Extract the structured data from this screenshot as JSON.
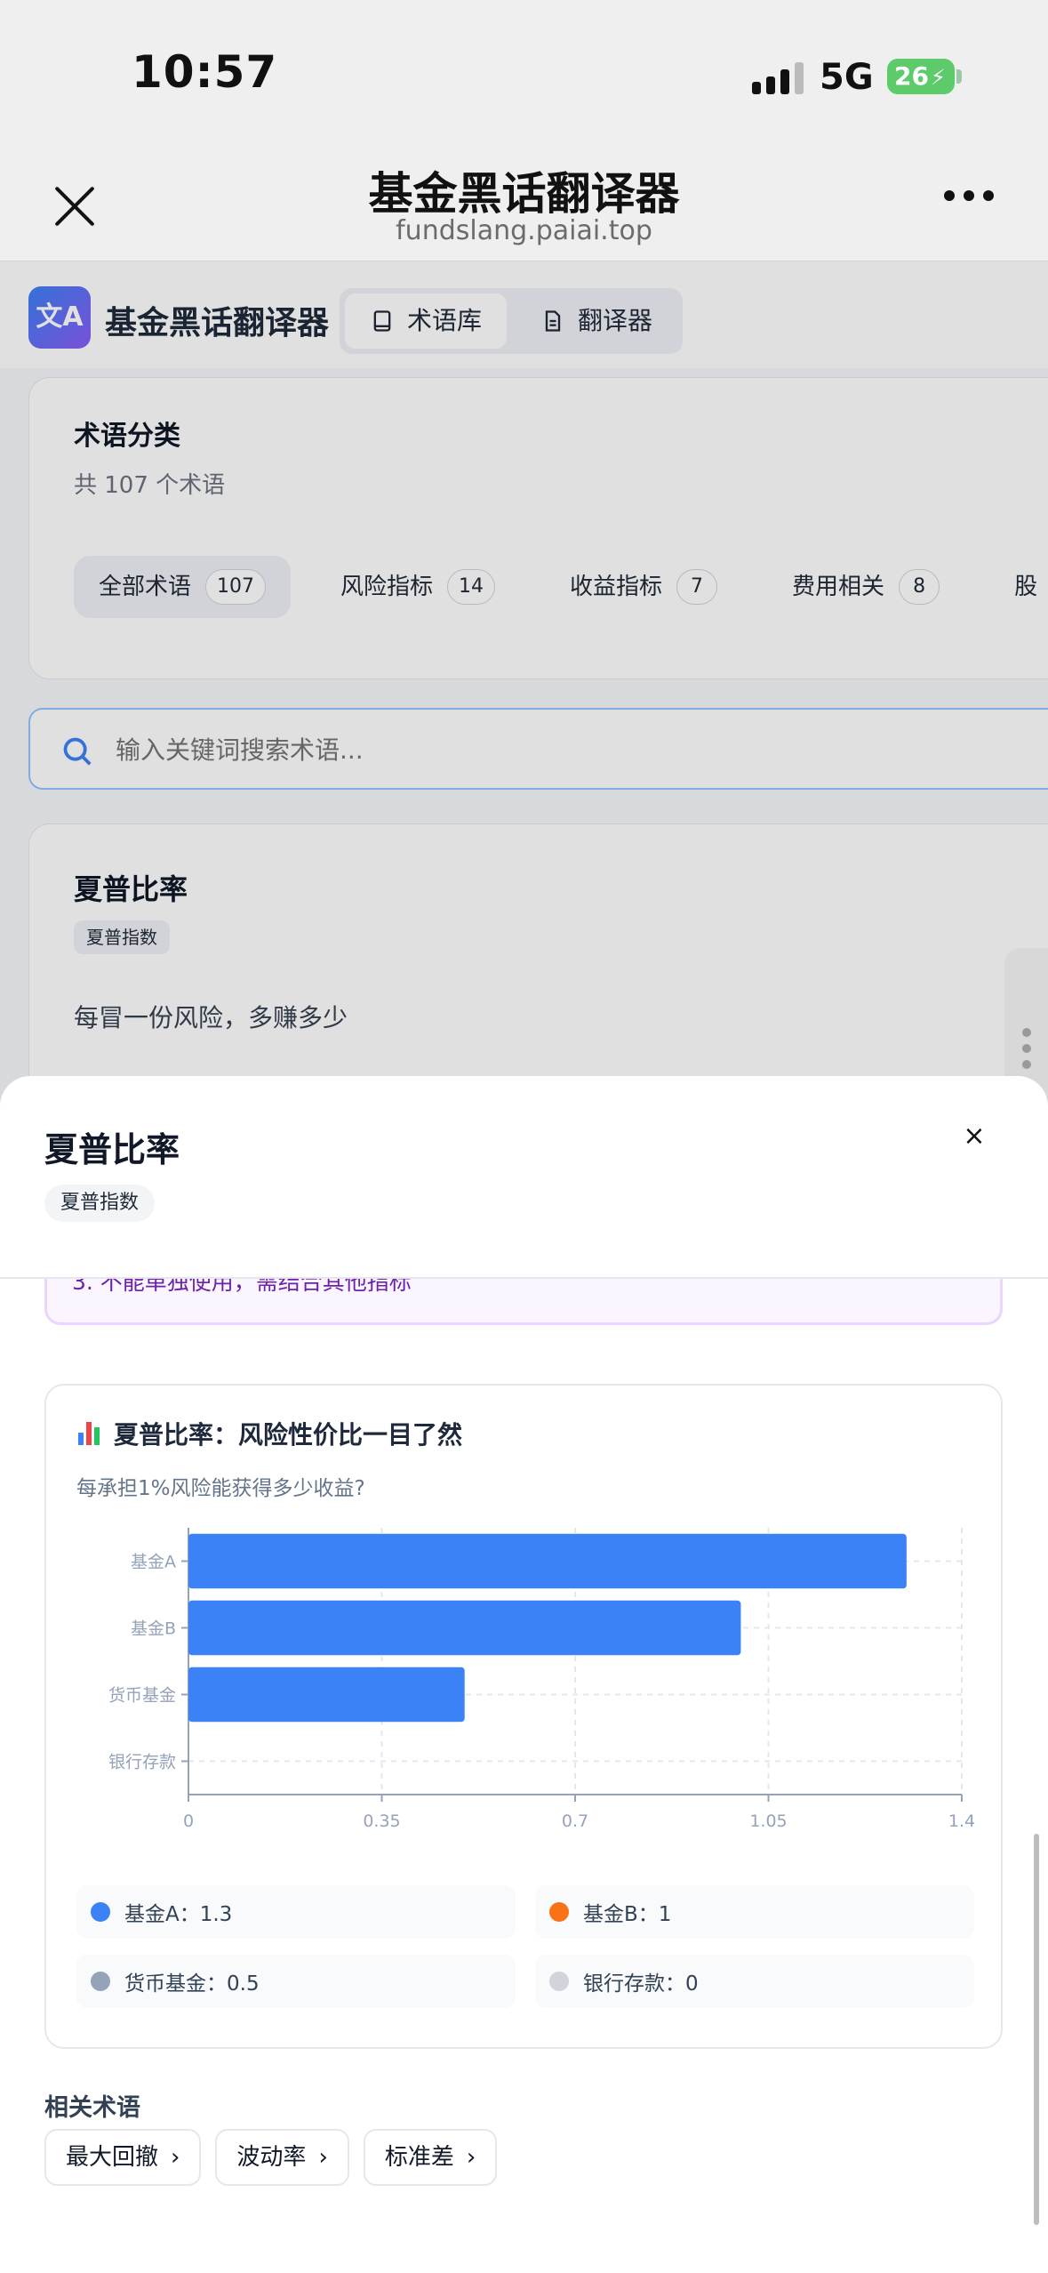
{
  "status": {
    "time": "10:57",
    "network": "5G",
    "battery": "26"
  },
  "browser": {
    "title": "基金黑话翻译器",
    "url": "fundslang.paiai.top"
  },
  "app": {
    "name": "基金黑话翻译器",
    "logo": "文A",
    "tabs": [
      {
        "label": "术语库",
        "icon": "book-icon"
      },
      {
        "label": "翻译器",
        "icon": "document-icon"
      }
    ]
  },
  "categories": {
    "title": "术语分类",
    "count_text": "共 107 个术语",
    "chips": [
      {
        "label": "全部术语",
        "count": "107"
      },
      {
        "label": "风险指标",
        "count": "14"
      },
      {
        "label": "收益指标",
        "count": "7"
      },
      {
        "label": "费用相关",
        "count": "8"
      },
      {
        "label": "股",
        "count": ""
      }
    ]
  },
  "search": {
    "placeholder": "输入关键词搜索术语..."
  },
  "term_card": {
    "title": "夏普比率",
    "tag": "夏普指数",
    "description": "每冒一份风险，多赚多少"
  },
  "sheet": {
    "title": "夏普比率",
    "tag": "夏普指数",
    "close": "×",
    "note": "3. 不能单独使用，需结合其他指标",
    "chart_title": "夏普比率：风险性价比一目了然",
    "chart_subtitle": "每承担1%风险能获得多少收益?",
    "legend": [
      {
        "label": "基金A：1.3",
        "color": "#3b82f6"
      },
      {
        "label": "基金B：1",
        "color": "#f97316"
      },
      {
        "label": "货币基金：0.5",
        "color": "#94a3b8"
      },
      {
        "label": "银行存款：0",
        "color": "#d1d5db"
      }
    ],
    "related_label": "相关术语",
    "related": [
      "最大回撤",
      "波动率",
      "标准差"
    ]
  },
  "chart_data": {
    "type": "bar",
    "orientation": "horizontal",
    "categories": [
      "基金A",
      "基金B",
      "货币基金",
      "银行存款"
    ],
    "values": [
      1.3,
      1,
      0.5,
      0
    ],
    "xlim": [
      0,
      1.4
    ],
    "xticks": [
      "0",
      "0.35",
      "0.7",
      "1.05",
      "1.4"
    ],
    "bar_color": "#3b82f6",
    "grid": true
  }
}
